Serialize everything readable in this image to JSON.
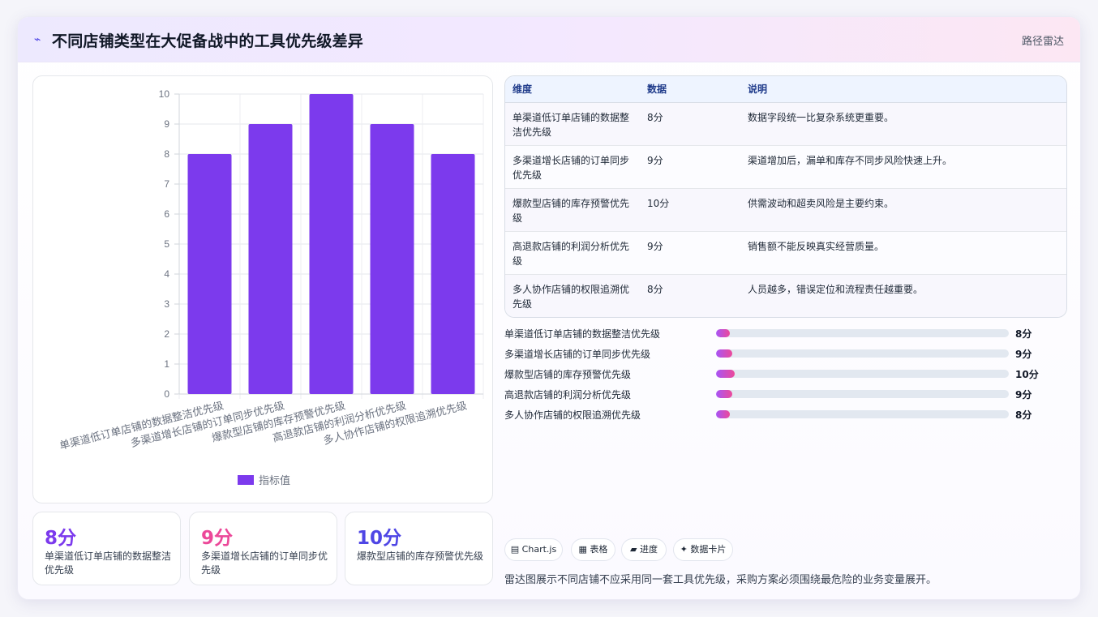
{
  "header": {
    "icon": "⌁",
    "title": "不同店铺类型在大促备战中的工具优先级差异",
    "tag": "路径雷达"
  },
  "chart_data": {
    "type": "bar",
    "categories": [
      "单渠道低订单店铺的数据整洁优先级",
      "多渠道增长店铺的订单同步优先级",
      "爆款型店铺的库存预警优先级",
      "高退款店铺的利润分析优先级",
      "多人协作店铺的权限追溯优先级"
    ],
    "series": [
      {
        "name": "指标值",
        "values": [
          8,
          9,
          10,
          9,
          8
        ]
      }
    ],
    "ylim": [
      0,
      10
    ],
    "yticks": [
      0,
      1,
      2,
      3,
      4,
      5,
      6,
      7,
      8,
      9,
      10
    ],
    "grid": true,
    "legend_position": "bottom",
    "color": "#7c3aed"
  },
  "stats": [
    {
      "value": "8分",
      "label": "单渠道低订单店铺的数据整洁优先级",
      "color": "#7c3aed"
    },
    {
      "value": "9分",
      "label": "多渠道增长店铺的订单同步优先级",
      "color": "#ec4899"
    },
    {
      "value": "10分",
      "label": "爆款型店铺的库存预警优先级",
      "color": "#4f46e5"
    }
  ],
  "table": {
    "headers": [
      "维度",
      "数据",
      "说明"
    ],
    "rows": [
      [
        "单渠道低订单店铺的数据整洁优先级",
        "8分",
        "数据字段统一比复杂系统更重要。"
      ],
      [
        "多渠道增长店铺的订单同步优先级",
        "9分",
        "渠道增加后，漏单和库存不同步风险快速上升。"
      ],
      [
        "爆款型店铺的库存预警优先级",
        "10分",
        "供需波动和超卖风险是主要约束。"
      ],
      [
        "高退款店铺的利润分析优先级",
        "9分",
        "销售额不能反映真实经营质量。"
      ],
      [
        "多人协作店铺的权限追溯优先级",
        "8分",
        "人员越多，错误定位和流程责任越重要。"
      ]
    ]
  },
  "progress": [
    {
      "label": "单渠道低订单店铺的数据整洁优先级",
      "value": "8分",
      "fraction": 0.048
    },
    {
      "label": "多渠道增长店铺的订单同步优先级",
      "value": "9分",
      "fraction": 0.056
    },
    {
      "label": "爆款型店铺的库存预警优先级",
      "value": "10分",
      "fraction": 0.064
    },
    {
      "label": "高退款店铺的利润分析优先级",
      "value": "9分",
      "fraction": 0.056
    },
    {
      "label": "多人协作店铺的权限追溯优先级",
      "value": "8分",
      "fraction": 0.048
    }
  ],
  "chips": [
    {
      "icon": "chart-icon",
      "label": "▤ Chart.js"
    },
    {
      "icon": "table-icon",
      "label": "▦ 表格"
    },
    {
      "icon": "progress-icon",
      "label": "▰ 进度"
    },
    {
      "icon": "sparkle-icon",
      "label": "✦ 数据卡片"
    }
  ],
  "footer": "雷达图展示不同店铺不应采用同一套工具优先级，采购方案必须围绕最危险的业务变量展开。"
}
